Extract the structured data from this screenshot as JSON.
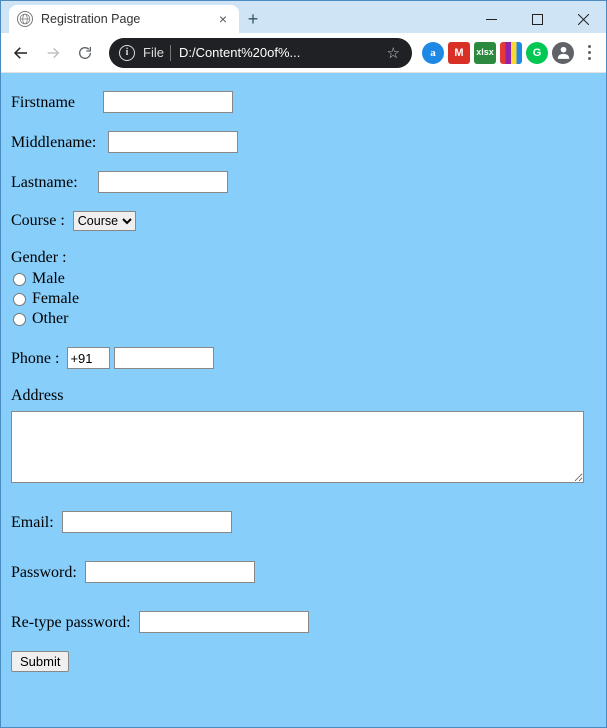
{
  "window": {
    "tab_title": "Registration Page"
  },
  "omnibox": {
    "file_label": "File",
    "url": "D:/Content%20of%..."
  },
  "extensions": {
    "a": "a",
    "m": "M",
    "g": "xlsx",
    "gr": "G"
  },
  "form": {
    "firstname_label": "Firstname",
    "middlename_label": "Middlename:",
    "lastname_label": "Lastname:",
    "course_label": "Course :",
    "course_selected": "Course",
    "gender_label": "Gender :",
    "gender_male": "Male",
    "gender_female": "Female",
    "gender_other": "Other",
    "phone_label": "Phone :",
    "phone_prefix": "+91",
    "address_label": "Address",
    "email_label": "Email:",
    "password_label": "Password:",
    "retype_label": "Re-type password:",
    "submit_label": "Submit"
  }
}
